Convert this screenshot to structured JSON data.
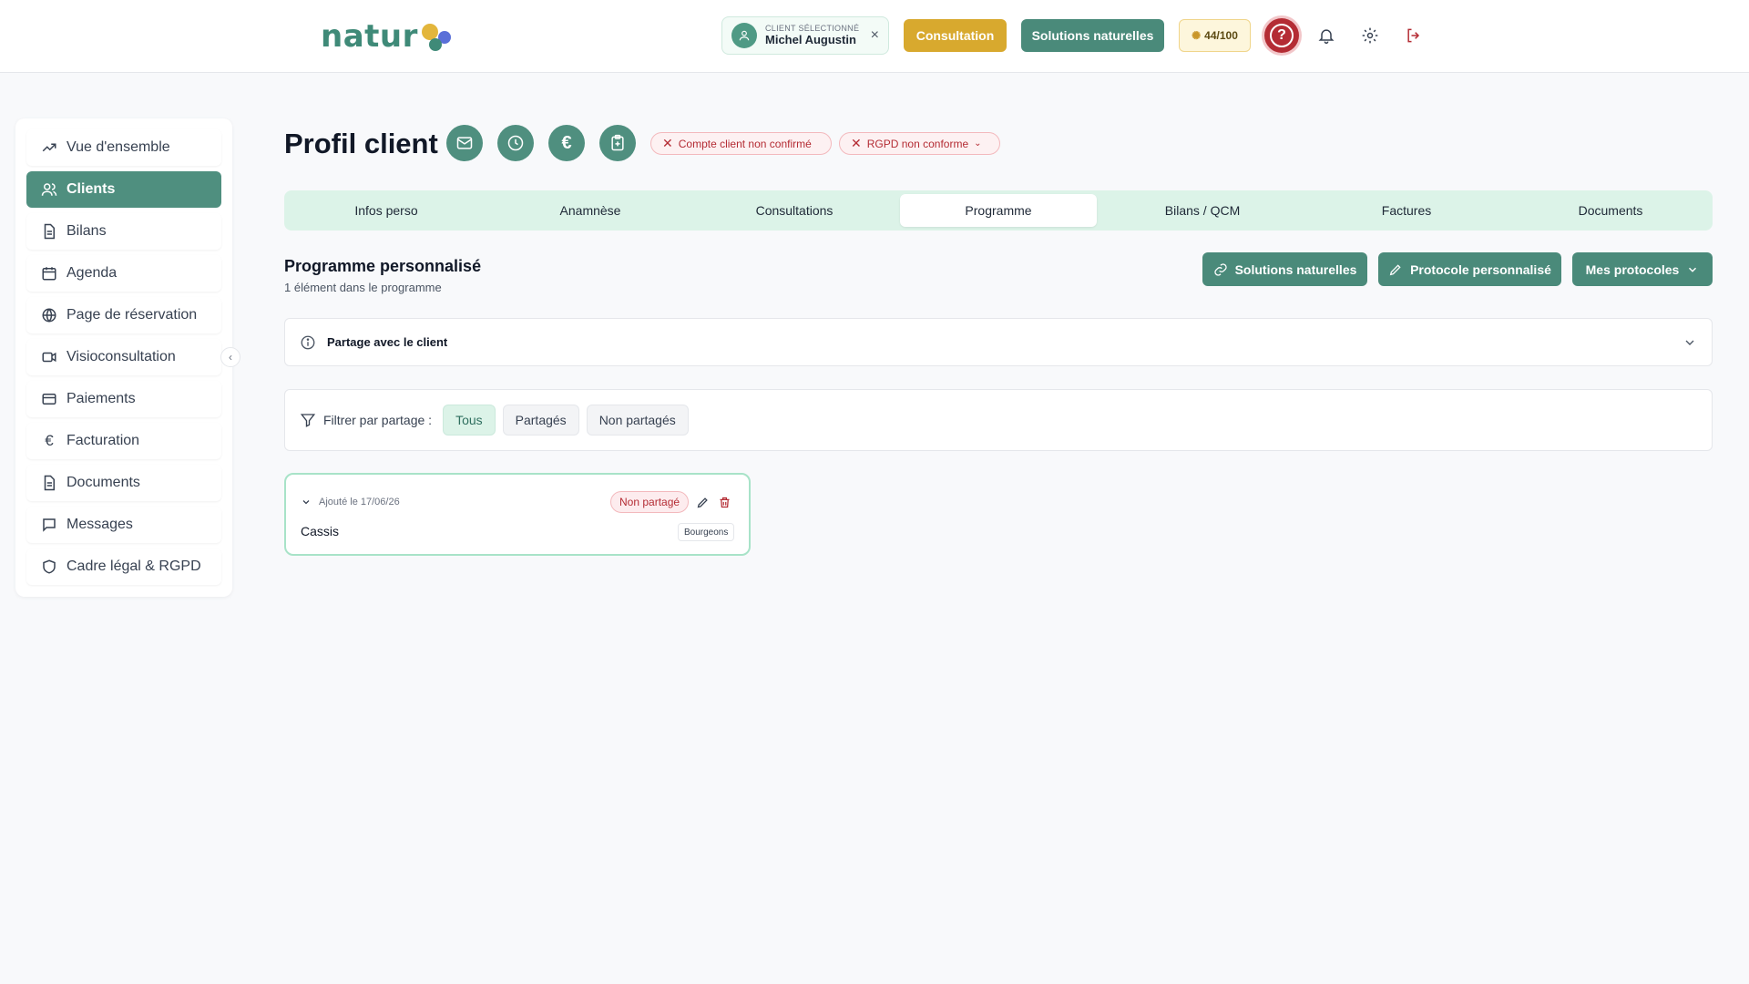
{
  "header": {
    "logo_text": "natur",
    "client_chip": {
      "small_label": "CLIENT SÉLECTIONNÉ",
      "name": "Michel Augustin",
      "close": "×"
    },
    "consultation_label": "Consultation",
    "solutions_label": "Solutions naturelles",
    "score": "44/100",
    "help_glyph": "?"
  },
  "sidebar": {
    "items": [
      {
        "label": "Vue d'ensemble",
        "icon": "trending-up-icon"
      },
      {
        "label": "Clients",
        "icon": "users-icon"
      },
      {
        "label": "Bilans",
        "icon": "document-icon"
      },
      {
        "label": "Agenda",
        "icon": "calendar-icon"
      },
      {
        "label": "Page de réservation",
        "icon": "globe-icon"
      },
      {
        "label": "Visioconsultation",
        "icon": "video-icon"
      },
      {
        "label": "Paiements",
        "icon": "credit-card-icon"
      },
      {
        "label": "Facturation",
        "icon": "euro-icon"
      },
      {
        "label": "Documents",
        "icon": "document-icon"
      },
      {
        "label": "Messages",
        "icon": "message-icon"
      },
      {
        "label": "Cadre légal & RGPD",
        "icon": "shield-icon"
      }
    ],
    "active_index": 1
  },
  "main": {
    "title": "Profil client",
    "badges": {
      "account": "Compte client non confirmé",
      "rgpd": "RGPD non conforme"
    },
    "tabs": [
      "Infos perso",
      "Anamnèse",
      "Consultations",
      "Programme",
      "Bilans / QCM",
      "Factures",
      "Documents"
    ],
    "active_tab": 3,
    "program": {
      "title": "Programme personnalisé",
      "subtitle": "1 élément dans le programme",
      "buttons": {
        "solutions": "Solutions naturelles",
        "protocol": "Protocole personnalisé",
        "my_protocols": "Mes protocoles"
      },
      "share_label": "Partage avec le client",
      "filter": {
        "label": "Filtrer par partage :",
        "options": [
          "Tous",
          "Partagés",
          "Non partagés"
        ],
        "active": 0
      },
      "items": [
        {
          "date": "Ajouté le 17/06/26",
          "status": "Non partagé",
          "name": "Cassis",
          "tag": "Bourgeons"
        }
      ]
    }
  },
  "colors": {
    "primary": "#4f8f7f",
    "accent_yellow": "#d8a92e",
    "danger": "#b42c34",
    "tab_bg": "#dcf3e8"
  }
}
